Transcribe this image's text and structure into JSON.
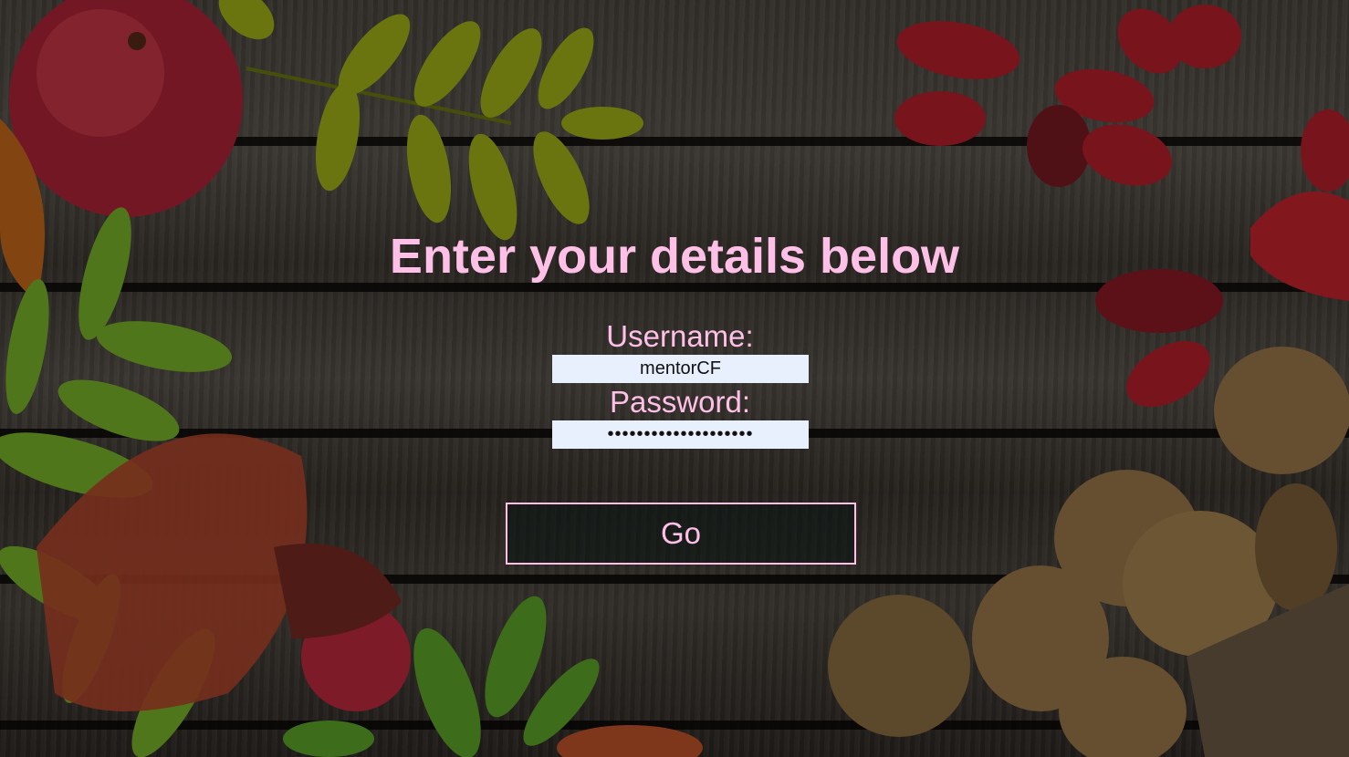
{
  "page": {
    "title": "Enter your details below",
    "accent_color": "#ffc0e8"
  },
  "form": {
    "username_label": "Username:",
    "username_value": "mentorCF",
    "password_label": "Password:",
    "password_value": "••••••••••••••••••••",
    "submit_label": "Go"
  },
  "background": {
    "icons": [
      "apple-icon",
      "leaf-icon",
      "rosehip-icon",
      "walnut-icon",
      "wood-planks"
    ]
  }
}
